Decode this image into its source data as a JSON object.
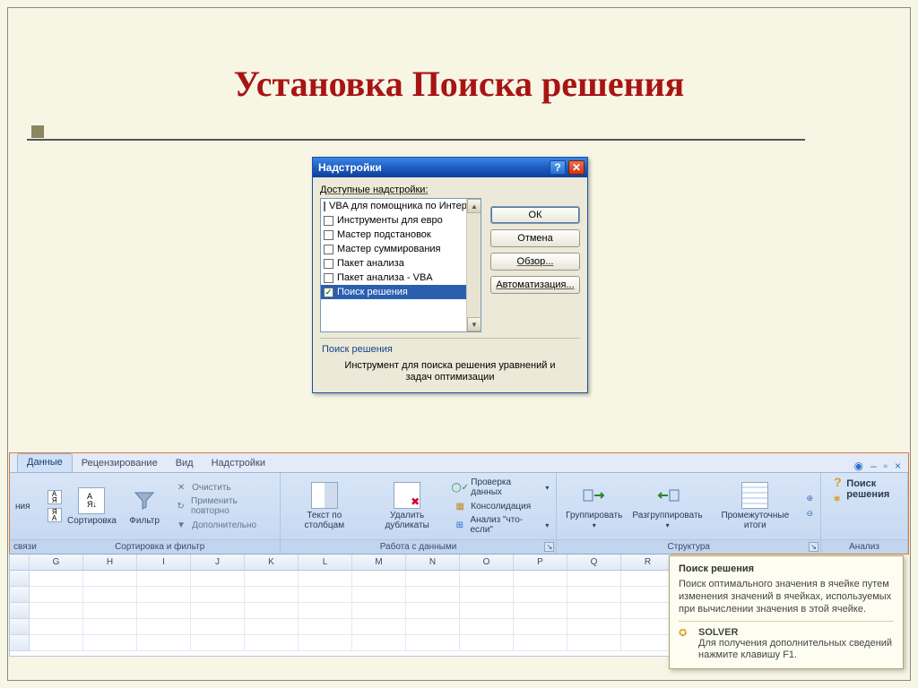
{
  "slide": {
    "title": "Установка Поиска решения"
  },
  "dialog": {
    "title": "Надстройки",
    "available_label": "Доступные надстройки:",
    "items": [
      {
        "label": "VBA для помощника по Интернету",
        "checked": false
      },
      {
        "label": "Инструменты для евро",
        "checked": false
      },
      {
        "label": "Мастер подстановок",
        "checked": false
      },
      {
        "label": "Мастер суммирования",
        "checked": false
      },
      {
        "label": "Пакет анализа",
        "checked": false
      },
      {
        "label": "Пакет анализа - VBA",
        "checked": false
      },
      {
        "label": "Поиск решения",
        "checked": true
      }
    ],
    "buttons": {
      "ok": "ОК",
      "cancel": "Отмена",
      "browse": "Обзор...",
      "automation": "Автоматизация..."
    },
    "section_title": "Поиск решения",
    "description": "Инструмент для поиска решения уравнений и задач оптимизации"
  },
  "ribbon": {
    "tabs": {
      "active": "Данные",
      "others": [
        "Рецензирование",
        "Вид",
        "Надстройки"
      ]
    },
    "frag": {
      "top": "ния",
      "bottom": "связи"
    },
    "sort_group": {
      "label": "Сортировка и фильтр",
      "sort_asc": "А↓Я",
      "sort_desc": "Я↓А",
      "sort": "Сортировка",
      "filter": "Фильтр",
      "clear": "Очистить",
      "reapply": "Применить повторно",
      "advanced": "Дополнительно"
    },
    "data_group": {
      "label": "Работа с данными",
      "text_to_columns": "Текст по столбцам",
      "remove_dupes": "Удалить дубликаты",
      "data_validation": "Проверка данных",
      "consolidate": "Консолидация",
      "whatif": "Анализ \"что-если\""
    },
    "outline_group": {
      "label": "Структура",
      "group": "Группировать",
      "ungroup": "Разгруппировать",
      "subtotal": "Промежуточные итоги"
    },
    "analysis_group": {
      "label": "Анализ",
      "solver": "Поиск решения"
    }
  },
  "tooltip": {
    "title": "Поиск решения",
    "body": "Поиск оптимального значения в ячейке путем изменения значений в ячейках, используемых при вычислении значения в этой ячейке.",
    "help_title": "SOLVER",
    "help_body": "Для получения дополнительных сведений нажмите клавишу F1."
  },
  "sheet": {
    "columns": [
      "G",
      "H",
      "I",
      "J",
      "K",
      "L",
      "M",
      "N",
      "O",
      "P",
      "Q",
      "R"
    ]
  }
}
